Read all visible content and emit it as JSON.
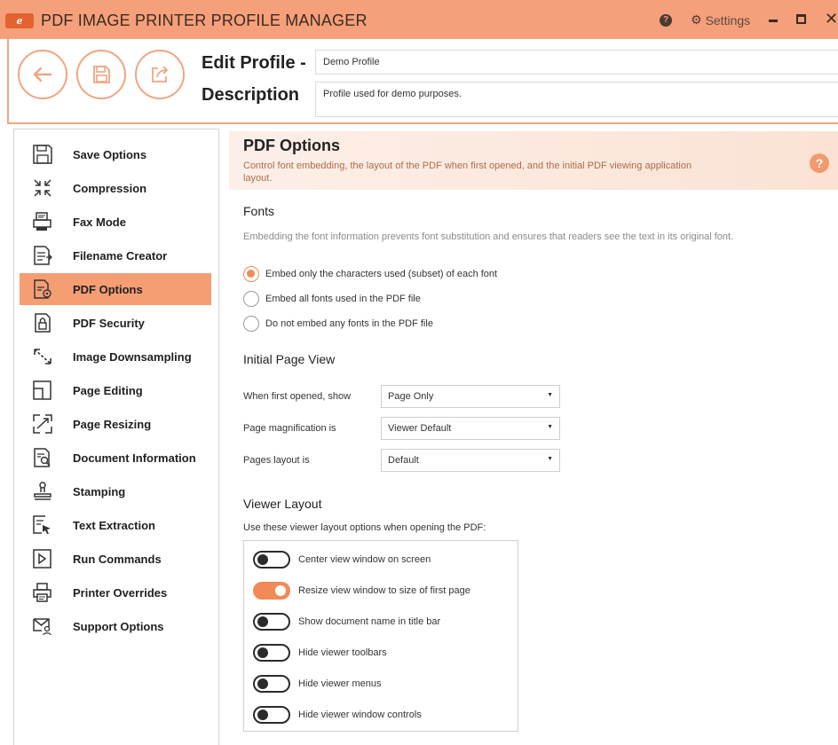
{
  "window": {
    "logo_text": "ℯ",
    "title": "PDF IMAGE PRINTER PROFILE MANAGER",
    "help_glyph": "?",
    "settings_label": "Settings",
    "close_glyph": "✕"
  },
  "header": {
    "edit_profile_label": "Edit Profile -",
    "profile_name": "Demo Profile",
    "description_label": "Description",
    "description_value": "Profile used for demo purposes."
  },
  "sidebar": {
    "items": [
      {
        "label": "Save Options",
        "icon": "save-icon"
      },
      {
        "label": "Compression",
        "icon": "compress-icon"
      },
      {
        "label": "Fax Mode",
        "icon": "fax-icon"
      },
      {
        "label": "Filename Creator",
        "icon": "filename-icon"
      },
      {
        "label": "PDF Options",
        "icon": "pdf-options-icon",
        "active": true
      },
      {
        "label": "PDF Security",
        "icon": "lock-icon"
      },
      {
        "label": "Image Downsampling",
        "icon": "downsample-icon"
      },
      {
        "label": "Page Editing",
        "icon": "page-edit-icon"
      },
      {
        "label": "Page Resizing",
        "icon": "resize-icon"
      },
      {
        "label": "Document Information",
        "icon": "doc-info-icon"
      },
      {
        "label": "Stamping",
        "icon": "stamp-icon"
      },
      {
        "label": "Text Extraction",
        "icon": "text-extract-icon"
      },
      {
        "label": "Run Commands",
        "icon": "run-icon"
      },
      {
        "label": "Printer Overrides",
        "icon": "printer-icon"
      },
      {
        "label": "Support Options",
        "icon": "support-icon"
      }
    ]
  },
  "main": {
    "title": "PDF Options",
    "description": "Control font embedding, the layout of the PDF when first opened, and the initial PDF viewing application layout.",
    "help_glyph": "?",
    "fonts": {
      "title": "Fonts",
      "description": "Embedding the font information prevents font substitution and ensures that readers see the text in its original font.",
      "options": [
        {
          "label": "Embed only the characters used (subset) of each font",
          "selected": true
        },
        {
          "label": "Embed all fonts used in the PDF file",
          "selected": false
        },
        {
          "label": "Do not embed any fonts in the PDF file",
          "selected": false
        }
      ]
    },
    "initial_view": {
      "title": "Initial Page View",
      "fields": [
        {
          "label": "When first opened, show",
          "value": "Page Only"
        },
        {
          "label": "Page magnification is",
          "value": "Viewer Default"
        },
        {
          "label": "Pages layout is",
          "value": "Default"
        }
      ],
      "arrow_glyph": "▼"
    },
    "viewer_layout": {
      "title": "Viewer Layout",
      "description": "Use these viewer layout options when opening the PDF:",
      "toggles": [
        {
          "label": "Center view window on screen",
          "on": false
        },
        {
          "label": "Resize view window to size of first page",
          "on": true
        },
        {
          "label": "Show document name in title bar",
          "on": false
        },
        {
          "label": "Hide viewer toolbars",
          "on": false
        },
        {
          "label": "Hide viewer menus",
          "on": false
        },
        {
          "label": "Hide viewer window controls",
          "on": false
        }
      ]
    }
  },
  "colors": {
    "accent": "#f59e74",
    "titlebar": "#f5a07a",
    "toggle_on": "#f28a57"
  }
}
